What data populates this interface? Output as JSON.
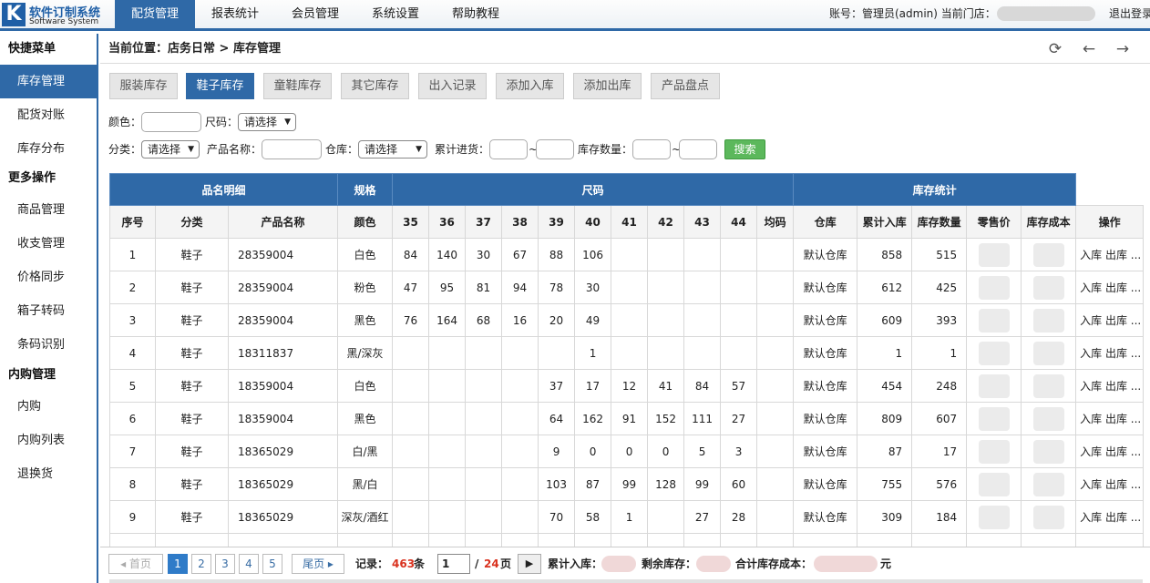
{
  "app": {
    "logo_letter": "K",
    "logo_cn": "软件订制系统",
    "logo_en": "Software System"
  },
  "nav": [
    "配货管理",
    "报表统计",
    "会员管理",
    "系统设置",
    "帮助教程"
  ],
  "account": {
    "label": "账号：管理员(admin)   当前门店：",
    "logout": "退出登录"
  },
  "sidebar": {
    "sections": [
      {
        "title": "快捷菜单",
        "items": [
          "库存管理",
          "配货对账",
          "库存分布"
        ]
      },
      {
        "title": "更多操作",
        "items": [
          "商品管理",
          "收支管理",
          "价格同步",
          "箱子转码",
          "条码识别"
        ]
      },
      {
        "title": "内购管理",
        "items": [
          "内购",
          "内购列表",
          "退换货"
        ]
      }
    ],
    "active": "库存管理"
  },
  "breadcrumb": "当前位置：店务日常 > 库存管理",
  "toolbar_icons": [
    "refresh-icon",
    "arrow-left-icon",
    "arrow-right-icon"
  ],
  "tabs": [
    "服装库存",
    "鞋子库存",
    "童鞋库存",
    "其它库存",
    "出入记录",
    "添加入库",
    "添加出库",
    "产品盘点"
  ],
  "active_tab": "鞋子库存",
  "filters": {
    "color_label": "颜色：",
    "size_label": "尺码：",
    "size_value": "请选择",
    "category_label": "分类：",
    "category_value": "请选择",
    "product_label": "产品名称：",
    "warehouse_label": "仓库：",
    "warehouse_value": "请选择",
    "total_in_label": "累计进货：",
    "stock_qty_label": "库存数量：",
    "tilde": "~",
    "search_button": "搜索"
  },
  "table": {
    "group_headers": [
      "品名明细",
      "规格",
      "尺码",
      "库存统计"
    ],
    "columns": [
      "序号",
      "分类",
      "产品名称",
      "颜色",
      "35",
      "36",
      "37",
      "38",
      "39",
      "40",
      "41",
      "42",
      "43",
      "44",
      "均码",
      "仓库",
      "累计入库",
      "库存数量",
      "零售价",
      "库存成本",
      "操作"
    ],
    "rows": [
      [
        "1",
        "鞋子",
        "28359004",
        "白色",
        "84",
        "140",
        "30",
        "67",
        "88",
        "106",
        "",
        "",
        "",
        "",
        "",
        "默认仓库",
        "858",
        "515"
      ],
      [
        "2",
        "鞋子",
        "28359004",
        "粉色",
        "47",
        "95",
        "81",
        "94",
        "78",
        "30",
        "",
        "",
        "",
        "",
        "",
        "默认仓库",
        "612",
        "425"
      ],
      [
        "3",
        "鞋子",
        "28359004",
        "黑色",
        "76",
        "164",
        "68",
        "16",
        "20",
        "49",
        "",
        "",
        "",
        "",
        "",
        "默认仓库",
        "609",
        "393"
      ],
      [
        "4",
        "鞋子",
        "18311837",
        "黑/深灰",
        "",
        "",
        "",
        "",
        "",
        "1",
        "",
        "",
        "",
        "",
        "",
        "默认仓库",
        "1",
        "1"
      ],
      [
        "5",
        "鞋子",
        "18359004",
        "白色",
        "",
        "",
        "",
        "",
        "37",
        "17",
        "12",
        "41",
        "84",
        "57",
        "",
        "默认仓库",
        "454",
        "248"
      ],
      [
        "6",
        "鞋子",
        "18359004",
        "黑色",
        "",
        "",
        "",
        "",
        "64",
        "162",
        "91",
        "152",
        "111",
        "27",
        "",
        "默认仓库",
        "809",
        "607"
      ],
      [
        "7",
        "鞋子",
        "18365029",
        "白/黑",
        "",
        "",
        "",
        "",
        "9",
        "0",
        "0",
        "0",
        "5",
        "3",
        "",
        "默认仓库",
        "87",
        "17"
      ],
      [
        "8",
        "鞋子",
        "18365029",
        "黑/白",
        "",
        "",
        "",
        "",
        "103",
        "87",
        "99",
        "128",
        "99",
        "60",
        "",
        "默认仓库",
        "755",
        "576"
      ],
      [
        "9",
        "鞋子",
        "18365029",
        "深灰/酒红",
        "",
        "",
        "",
        "",
        "70",
        "58",
        "1",
        "",
        "27",
        "28",
        "",
        "默认仓库",
        "309",
        "184"
      ]
    ],
    "row_actions": "入库 出库 ..."
  },
  "pager": {
    "first": "◂ 首页",
    "pages": [
      "1",
      "2",
      "3",
      "4",
      "5"
    ],
    "last": "尾页 ▸",
    "records_label": "记录：",
    "records_count": "463",
    "records_unit": "条",
    "page_input": "1",
    "page_sep": "/",
    "page_total": "24",
    "page_unit": "页",
    "go": "▶",
    "total_in_label": "累计入库：",
    "remaining_label": "剩余库存：",
    "cost_label": "合计库存成本：",
    "currency_unit": "元"
  },
  "colors": {
    "brand": "#2f69a7",
    "search": "#5cb85c",
    "count_red": "#d9321f"
  }
}
